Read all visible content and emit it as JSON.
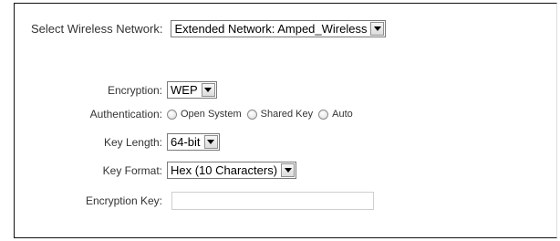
{
  "network": {
    "label": "Select Wireless Network:",
    "selected": "Extended Network: Amped_Wireless"
  },
  "encryption": {
    "label": "Encryption:",
    "selected": "WEP"
  },
  "authentication": {
    "label": "Authentication:",
    "options": [
      "Open System",
      "Shared Key",
      "Auto"
    ]
  },
  "key_length": {
    "label": "Key Length:",
    "selected": "64-bit"
  },
  "key_format": {
    "label": "Key Format:",
    "selected": "Hex (10 Characters)"
  },
  "encryption_key": {
    "label": "Encryption Key:",
    "value": ""
  }
}
